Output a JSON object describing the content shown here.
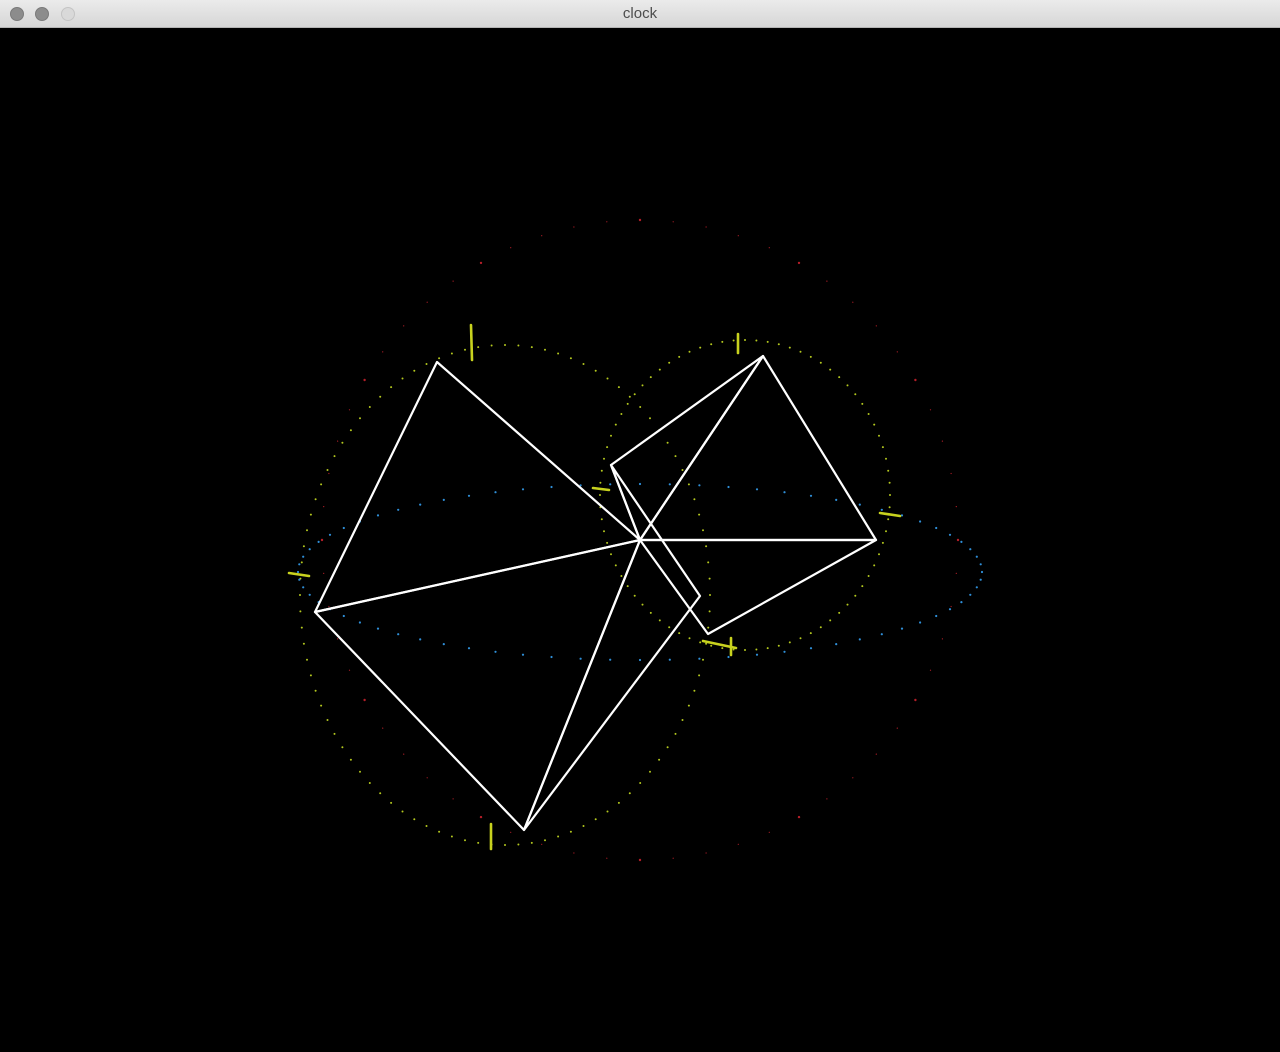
{
  "window": {
    "title": "clock"
  },
  "colors": {
    "background": "#000000",
    "hands": "#ffffff",
    "ticks": "#c8d21e",
    "outer_dots": "#b41e28",
    "blue_dots": "#2f8fd8",
    "yellow_dots": "#b4c81e"
  }
}
